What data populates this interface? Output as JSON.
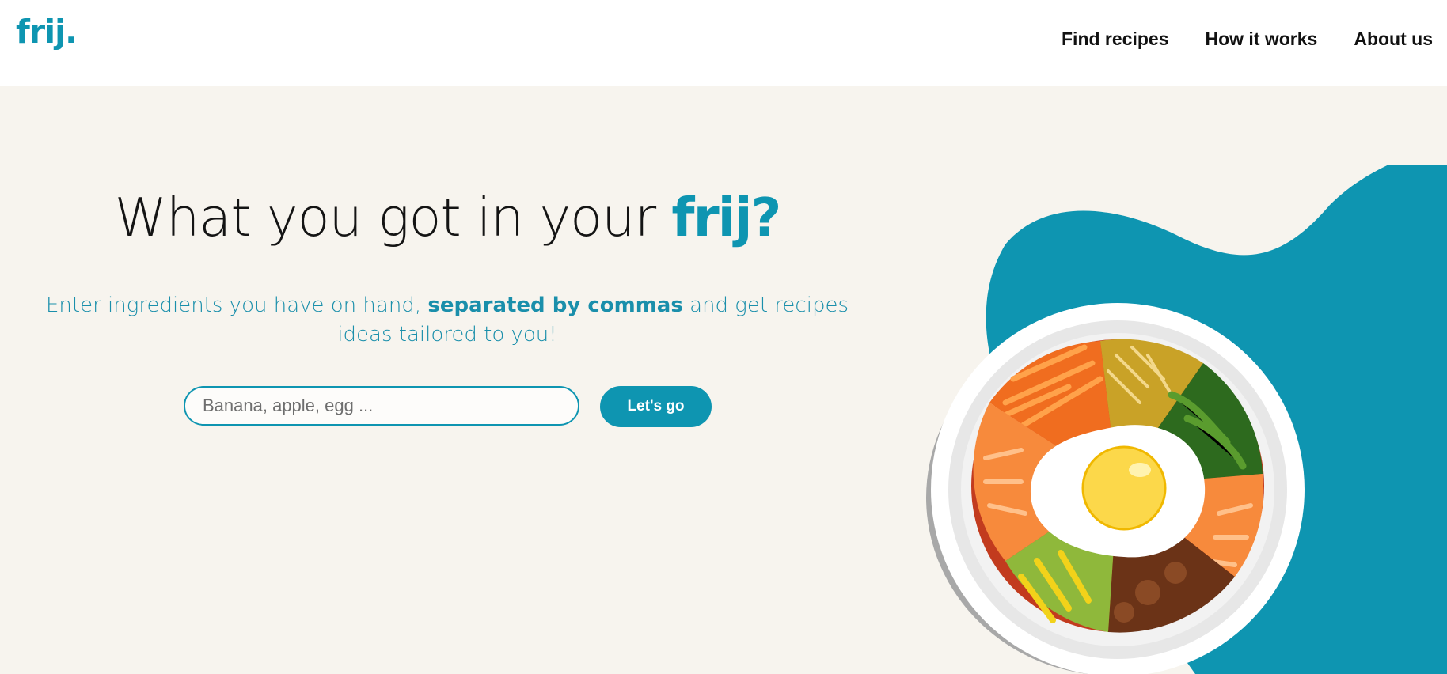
{
  "header": {
    "logo": "frij.",
    "nav": [
      {
        "label": "Find recipes"
      },
      {
        "label": "How it works"
      },
      {
        "label": "About us"
      }
    ]
  },
  "hero": {
    "title_prefix": "What you got in your ",
    "title_brand": "frij?",
    "subtitle_part1": "Enter ingredients you have on hand, ",
    "subtitle_bold": "separated by commas",
    "subtitle_part2": " and get recipes ideas tailored to you!",
    "search_placeholder": "Banana, apple, egg ...",
    "button_label": "Let's go"
  },
  "illustration": {
    "icon": "bibimbap-bowl-icon"
  },
  "colors": {
    "brand": "#0e95b1",
    "background": "#f7f4ee",
    "header": "#ffffff"
  }
}
